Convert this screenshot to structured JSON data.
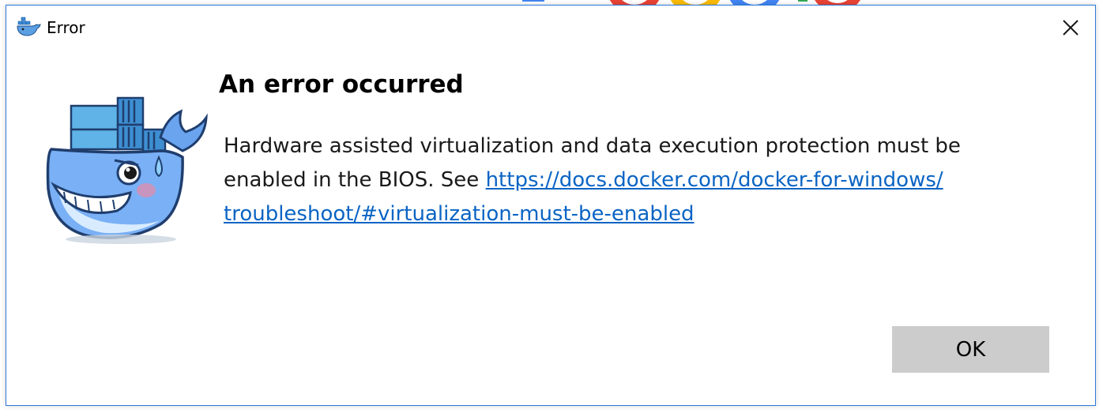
{
  "window": {
    "title": "Error",
    "app_icon": "docker-whale-icon",
    "close_icon": "close-icon",
    "border_color": "#2b79d7"
  },
  "dialog": {
    "mascot_icon": "docker-whale-sad-icon",
    "heading": "An error occurred",
    "message_text": "Hardware assisted virtualization and data execution protection must be enabled in the BIOS. See ",
    "message_link": "https://docs.docker.com/docker-for-windows/troubleshoot/#virtualization-must-be-enabled",
    "link_color": "#0a64c4",
    "ok_label": "OK",
    "ok_button_color": "#cccccc"
  }
}
